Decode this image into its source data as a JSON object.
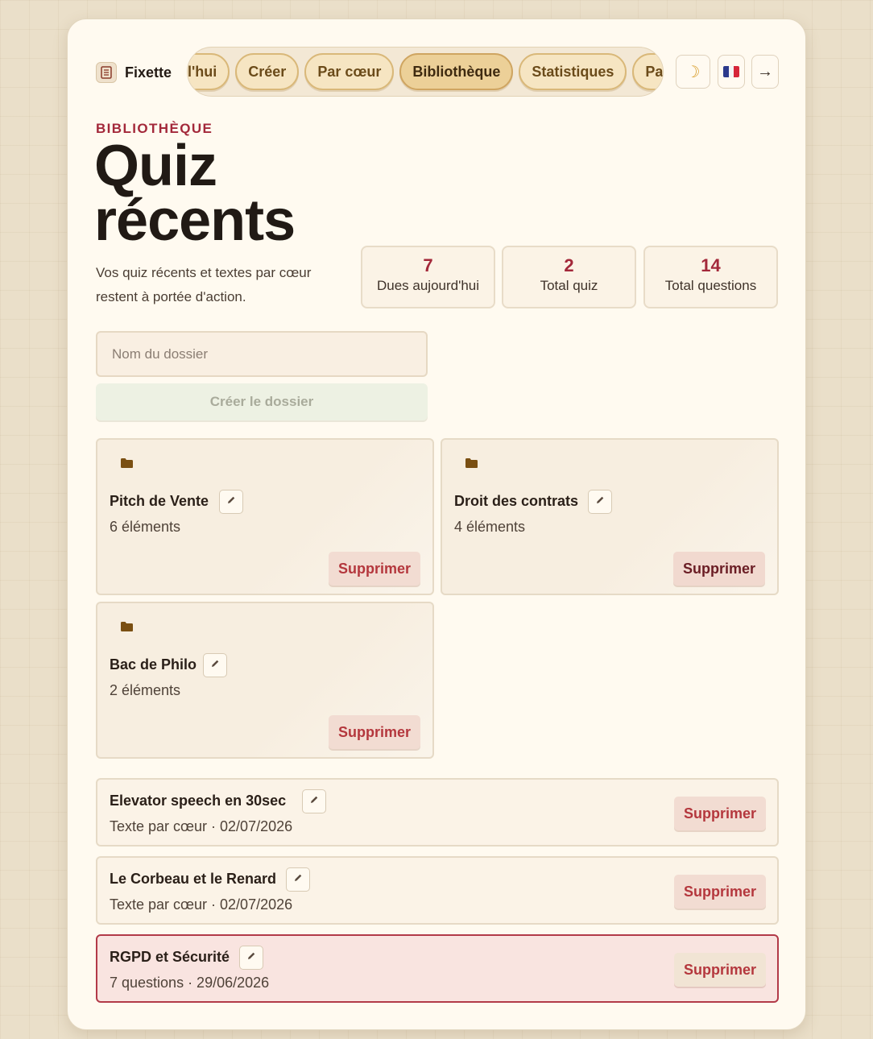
{
  "brand": {
    "name": "Fixette",
    "icon": "notebook-icon"
  },
  "nav": {
    "tabs": [
      {
        "label": "l'hui",
        "active": false
      },
      {
        "label": "Créer",
        "active": false
      },
      {
        "label": "Par cœur",
        "active": false
      },
      {
        "label": "Bibliothèque",
        "active": true
      },
      {
        "label": "Statistiques",
        "active": false
      },
      {
        "label": "Pa",
        "active": false
      }
    ]
  },
  "actions": {
    "theme_icon": "☽",
    "logout_icon": "→"
  },
  "header": {
    "eyebrow": "BIBLIOTHÈQUE",
    "title_line1": "Quiz",
    "title_line2": "récents",
    "subtitle": "Vos quiz récents et textes par cœur restent à portée d'action."
  },
  "stats": [
    {
      "value": "7",
      "label": "Dues aujourd'hui"
    },
    {
      "value": "2",
      "label": "Total quiz"
    },
    {
      "value": "14",
      "label": "Total questions"
    }
  ],
  "folder_form": {
    "placeholder": "Nom du dossier",
    "create_label": "Créer le dossier"
  },
  "folders": [
    {
      "name": "Pitch de Vente",
      "count": "6 éléments",
      "delete_label": "Supprimer"
    },
    {
      "name": "Droit des contrats",
      "count": "4 éléments",
      "delete_label": "Supprimer"
    },
    {
      "name": "Bac de Philo",
      "count": "2 éléments",
      "delete_label": "Supprimer"
    }
  ],
  "items": [
    {
      "title": "Elevator speech en 30sec",
      "meta": "Texte par cœur · 02/07/2026",
      "delete_label": "Supprimer"
    },
    {
      "title": "Le Corbeau et le Renard",
      "meta": "Texte par cœur · 02/07/2026",
      "delete_label": "Supprimer"
    },
    {
      "title": "RGPD et Sécurité",
      "meta": "7 questions · 29/06/2026",
      "delete_label": "Supprimer"
    }
  ],
  "colors": {
    "accent": "#a3283a",
    "pill": "#f6e5c2",
    "folder": "#7a4f12"
  }
}
